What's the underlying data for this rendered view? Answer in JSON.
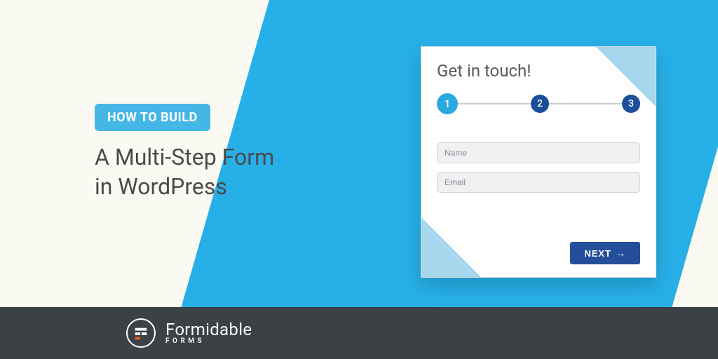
{
  "pill_label": "HOW TO BUILD",
  "headline_line1": "A Multi-Step Form",
  "headline_line2": "in WordPress",
  "card": {
    "title": "Get in touch!",
    "steps": [
      "1",
      "2",
      "3"
    ],
    "name_placeholder": "Name",
    "email_placeholder": "Email",
    "next_label": "NEXT"
  },
  "brand": {
    "name": "Formidable",
    "sub": "FORMS"
  },
  "colors": {
    "accent_light": "#27b0e8",
    "accent_dark": "#244e9a",
    "cream": "#fbfaf2",
    "footer": "#3c4146"
  }
}
